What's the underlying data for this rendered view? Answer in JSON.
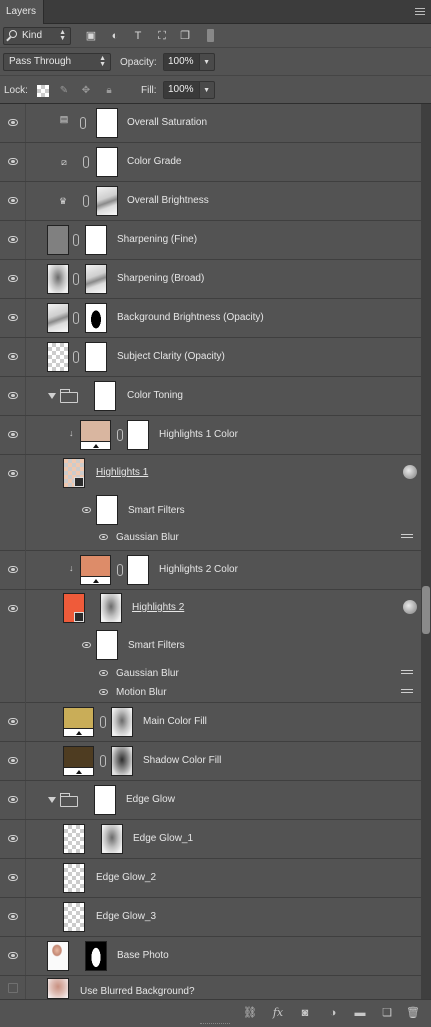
{
  "panel": {
    "tab_label": "Layers",
    "filter": {
      "kind_label": "Kind",
      "icons": [
        "image-filter-icon",
        "adjustment-filter-icon",
        "type-filter-icon",
        "shape-filter-icon",
        "smart-object-filter-icon",
        "filter-toggle-icon"
      ]
    },
    "blend_mode": "Pass Through",
    "opacity_label": "Opacity:",
    "opacity_value": "100%",
    "lock_label": "Lock:",
    "lock_icons": [
      "lock-transparent-icon",
      "lock-image-icon",
      "lock-position-icon",
      "lock-all-icon"
    ],
    "fill_label": "Fill:",
    "fill_value": "100%"
  },
  "layers": [
    {
      "name": "Overall Saturation",
      "visible": true
    },
    {
      "name": "Color Grade",
      "visible": true
    },
    {
      "name": "Overall Brightness",
      "visible": true
    },
    {
      "name": "Sharpening (Fine)",
      "visible": true
    },
    {
      "name": "Sharpening (Broad)",
      "visible": true
    },
    {
      "name": "Background Brightness (Opacity)",
      "visible": true
    },
    {
      "name": "Subject Clarity (Opacity)",
      "visible": true
    },
    {
      "name": "Color Toning",
      "visible": true,
      "group": true
    },
    {
      "name": "Highlights 1 Color",
      "visible": true,
      "color": "#d9b6a0"
    },
    {
      "name": "Highlights 1",
      "visible": true,
      "smart_object": true
    },
    {
      "name": "Smart Filters"
    },
    {
      "name": "Gaussian Blur"
    },
    {
      "name": "Highlights 2 Color",
      "visible": true,
      "color": "#dd8c69"
    },
    {
      "name": "Highlights 2",
      "visible": true,
      "smart_object": true,
      "color": "#ef5b3a"
    },
    {
      "name": "Smart Filters"
    },
    {
      "name": "Gaussian Blur"
    },
    {
      "name": "Motion Blur"
    },
    {
      "name": "Main Color Fill",
      "visible": true,
      "color": "#c9ad58"
    },
    {
      "name": "Shadow Color Fill",
      "visible": true,
      "color": "#4e3c21"
    },
    {
      "name": "Edge Glow",
      "visible": true,
      "group": true
    },
    {
      "name": "Edge Glow_1",
      "visible": true
    },
    {
      "name": "Edge Glow_2",
      "visible": true
    },
    {
      "name": "Edge Glow_3",
      "visible": true
    },
    {
      "name": "Base Photo",
      "visible": true
    },
    {
      "name": "Use Blurred Background?",
      "visible": false
    }
  ],
  "footer_icons": [
    "link-layers-icon",
    "fx-icon",
    "add-mask-icon",
    "adjustment-layer-icon",
    "new-group-icon",
    "new-layer-icon",
    "delete-layer-icon"
  ]
}
